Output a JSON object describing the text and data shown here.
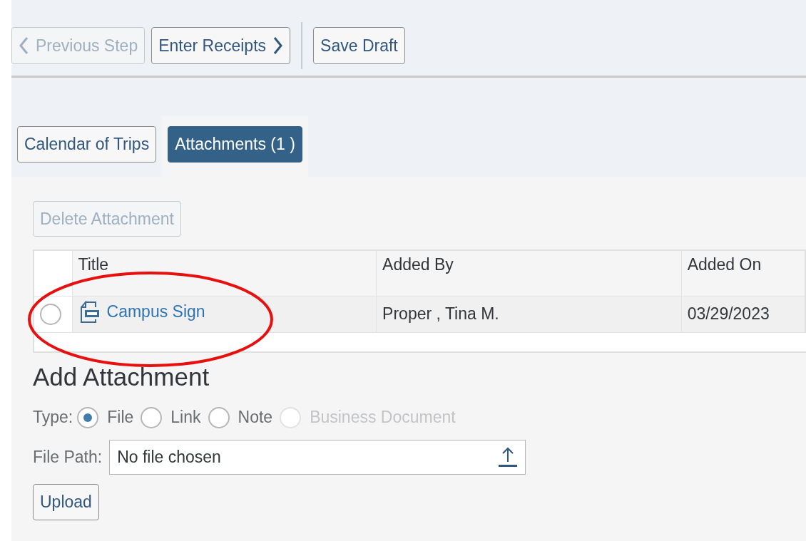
{
  "toolbar": {
    "buttons": [
      {
        "label": "Previous Step",
        "kind": "back",
        "disabled": true
      },
      {
        "label": "Enter Receipts",
        "kind": "forward",
        "disabled": false
      },
      {
        "label": "Save Draft",
        "kind": "plain",
        "disabled": false
      }
    ]
  },
  "tabs": [
    {
      "label": "Calendar of Trips",
      "selected": false
    },
    {
      "label": "Attachments (1 )",
      "selected": true
    }
  ],
  "delete_button": {
    "label": "Delete Attachment",
    "disabled": true
  },
  "table": {
    "columns": [
      "Title",
      "Added By",
      "Added On"
    ],
    "rows": [
      {
        "selected": false,
        "title": "Campus Sign",
        "added_by": "Proper , Tina M.",
        "added_on": "03/29/2023"
      }
    ]
  },
  "add_attachment": {
    "heading": "Add Attachment",
    "type_label": "Type:",
    "types": [
      {
        "label": "File",
        "selected": true,
        "disabled": false
      },
      {
        "label": "Link",
        "selected": false,
        "disabled": false
      },
      {
        "label": "Note",
        "selected": false,
        "disabled": false
      },
      {
        "label": "Business Document",
        "selected": false,
        "disabled": true
      }
    ],
    "file_path_label": "File Path:",
    "file_path": {
      "value": "No file chosen"
    },
    "upload_button": "Upload"
  }
}
